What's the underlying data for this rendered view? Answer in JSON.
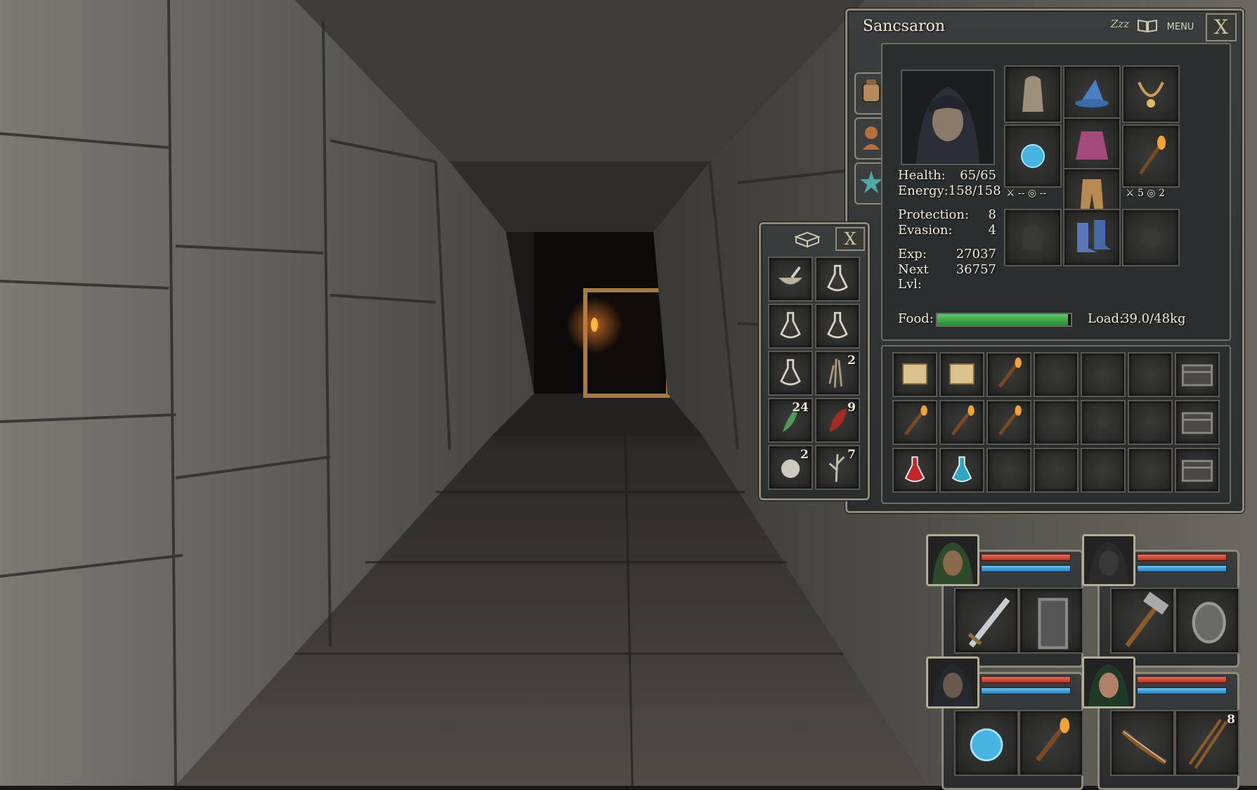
{
  "character": {
    "name": "Sancsaron",
    "rest_icon_label": "Zzz",
    "menu_label": "MENU",
    "close_label": "X",
    "stats": {
      "health_label": "Health:",
      "health_value": "65/65",
      "energy_label": "Energy:",
      "energy_value": "158/158",
      "protection_label": "Protection:",
      "protection_value": "8",
      "evasion_label": "Evasion:",
      "evasion_value": "4",
      "exp_label": "Exp:",
      "exp_value": "27037",
      "next_label": "Next Lvl:",
      "next_value": "36757"
    },
    "food_label": "Food:",
    "food_level": 0.98,
    "load_label": "Load:",
    "load_value": "39.0/48kg",
    "left_hand_stats": {
      "attack": "--",
      "defense": "--"
    },
    "right_hand_stats": {
      "attack": "5",
      "defense": "2"
    }
  },
  "container": {
    "close_label": "X",
    "items": [
      {
        "icon": "mortar-pestle-icon",
        "count": ""
      },
      {
        "icon": "empty-flask-icon",
        "count": ""
      },
      {
        "icon": "empty-flask-icon",
        "count": ""
      },
      {
        "icon": "empty-flask-icon",
        "count": ""
      },
      {
        "icon": "empty-flask-icon",
        "count": ""
      },
      {
        "icon": "root-herb-icon",
        "count": "2"
      },
      {
        "icon": "green-leaf-herb-icon",
        "count": "24"
      },
      {
        "icon": "red-herb-icon",
        "count": "9"
      },
      {
        "icon": "pearl-icon",
        "count": "2"
      },
      {
        "icon": "twig-herb-icon",
        "count": "7"
      }
    ]
  },
  "inventory": {
    "rows": [
      [
        "scroll-icon",
        "scroll-icon",
        "torch-icon",
        "",
        "",
        "",
        "chest-icon"
      ],
      [
        "torch-icon",
        "torch-icon",
        "torch-icon",
        "",
        "",
        "",
        "chest-icon"
      ],
      [
        "red-potion-icon",
        "blue-potion-icon",
        "",
        "",
        "",
        "",
        "chest-icon"
      ]
    ]
  },
  "party": [
    {
      "name": "party-member-1",
      "portrait": "green-warrior-portrait",
      "health": 1.0,
      "energy": 1.0,
      "left": "sword-icon",
      "right": "shield-icon",
      "right_count": ""
    },
    {
      "name": "party-member-2",
      "portrait": "minotaur-portrait",
      "health": 1.0,
      "energy": 1.0,
      "left": "hammer-icon",
      "right": "round-shield-icon",
      "right_count": ""
    },
    {
      "name": "party-member-3",
      "portrait": "hooded-mage-portrait",
      "health": 1.0,
      "energy": 1.0,
      "left": "orb-icon",
      "right": "torch-icon",
      "right_count": ""
    },
    {
      "name": "party-member-4",
      "portrait": "hooded-ranger-portrait",
      "health": 1.0,
      "energy": 1.0,
      "left": "bow-icon",
      "right": "arrows-icon",
      "right_count": "8"
    }
  ],
  "colors": {
    "health": "#d9483a",
    "energy": "#3f98d6",
    "food": "#3aa64a",
    "text": "#f0ead8",
    "frame": "#8d8a7c"
  }
}
